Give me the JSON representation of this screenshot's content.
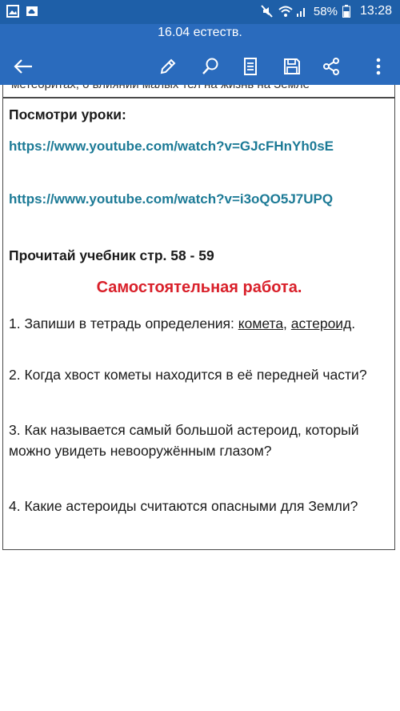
{
  "status_bar": {
    "battery_percent": "58%",
    "time": "13:28",
    "icons": [
      "image-icon",
      "cloud-icon",
      "mute-icon",
      "wifi-icon",
      "signal-icon",
      "battery-icon"
    ]
  },
  "app_bar": {
    "title": "16.04 естеств.",
    "icons": [
      "back-arrow-icon",
      "edit-pencil-icon",
      "search-icon",
      "reading-mode-icon",
      "save-icon",
      "share-icon",
      "more-icon"
    ]
  },
  "document": {
    "cut_line": "метеоритах, о влиянии малых тел на жизнь на Земле",
    "watch_heading": "Посмотри уроки:",
    "link1": "https://www.youtube.com/watch?v=GJcFHnYh0sE",
    "link2": "https://www.youtube.com/watch?v=i3oQO5J7UPQ",
    "read_textbook": "Прочитай учебник стр. 58 - 59",
    "section_title": "Самостоятельная работа.",
    "q1_prefix": "1. Запиши в тетрадь определения: ",
    "q1_term1": "комета,",
    "q1_term2": "астероид",
    "q1_suffix": ".",
    "q2": "2. Когда хвост кометы находится в её передней части?",
    "q3": "3. Как называется самый большой астероид, который можно увидеть невооружённым глазом?",
    "q4": "4. Какие астероиды считаются опасными для Земли?"
  },
  "colors": {
    "status_bar": "#1e5fa8",
    "app_bar": "#2a6bbd",
    "link": "#1c7a96",
    "section_title": "#d9202a"
  }
}
